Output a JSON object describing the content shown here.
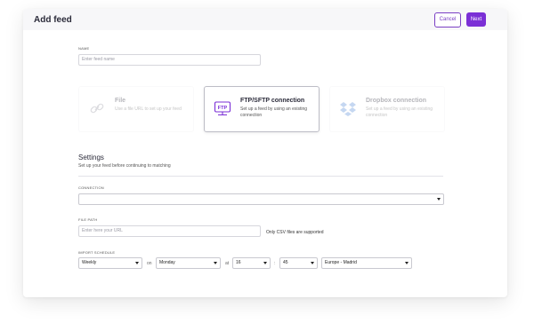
{
  "header": {
    "title": "Add feed",
    "cancel_label": "Cancel",
    "next_label": "Next"
  },
  "name_field": {
    "label": "NAME",
    "placeholder": "Enter feed name"
  },
  "sources": [
    {
      "title": "File",
      "description": "Use a file URL to set up your feed"
    },
    {
      "title": "FTP/SFTP connection",
      "description": "Set up a feed by using an existing connection",
      "icon_text": "FTP"
    },
    {
      "title": "Dropbox connection",
      "description": "Set up a feed by using an existing connection"
    }
  ],
  "settings": {
    "title": "Settings",
    "subtitle": "Set up your feed before continuing to matching",
    "connection_label": "CONNECTION",
    "connection_value": "",
    "file_path_label": "FILE PATH",
    "file_path_placeholder": "Enter here your URL",
    "file_path_note": "Only CSV files are supported",
    "schedule_label": "IMPORT SCHEDULE",
    "frequency": "Weekly",
    "on_label": "on",
    "day": "Monday",
    "at_label": "at",
    "hour": "16",
    "colon": ":",
    "minute": "45",
    "timezone": "Europe - Madrid"
  },
  "colors": {
    "accent": "#7b2fd6",
    "text": "#2b2b3a"
  }
}
